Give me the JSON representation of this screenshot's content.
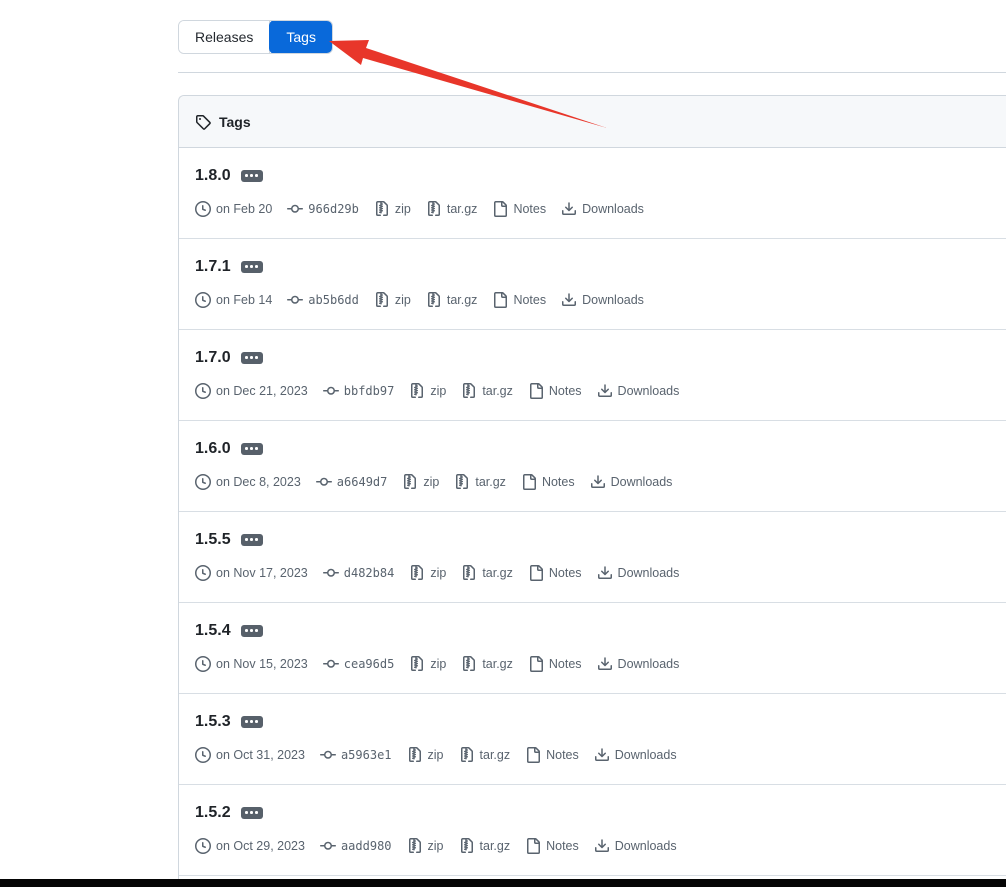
{
  "tabs": {
    "releases_label": "Releases",
    "tags_label": "Tags",
    "active_tab": "Tags"
  },
  "panel": {
    "title": "Tags"
  },
  "labels": {
    "zip": "zip",
    "targz": "tar.gz",
    "notes": "Notes",
    "downloads": "Downloads"
  },
  "tags": [
    {
      "name": "1.8.0",
      "date": "on Feb 20",
      "commit": "966d29b"
    },
    {
      "name": "1.7.1",
      "date": "on Feb 14",
      "commit": "ab5b6dd"
    },
    {
      "name": "1.7.0",
      "date": "on Dec 21, 2023",
      "commit": "bbfdb97"
    },
    {
      "name": "1.6.0",
      "date": "on Dec 8, 2023",
      "commit": "a6649d7"
    },
    {
      "name": "1.5.5",
      "date": "on Nov 17, 2023",
      "commit": "d482b84"
    },
    {
      "name": "1.5.4",
      "date": "on Nov 15, 2023",
      "commit": "cea96d5"
    },
    {
      "name": "1.5.3",
      "date": "on Oct 31, 2023",
      "commit": "a5963e1"
    },
    {
      "name": "1.5.2",
      "date": "on Oct 29, 2023",
      "commit": "aadd980"
    }
  ],
  "colors": {
    "accent_blue": "#0969da",
    "arrow_red": "#e8362a",
    "border": "#d0d7de",
    "header_bg": "#f6f8fa",
    "text": "#1f2328",
    "muted": "#59636e",
    "bottom_bar": "#050505"
  }
}
